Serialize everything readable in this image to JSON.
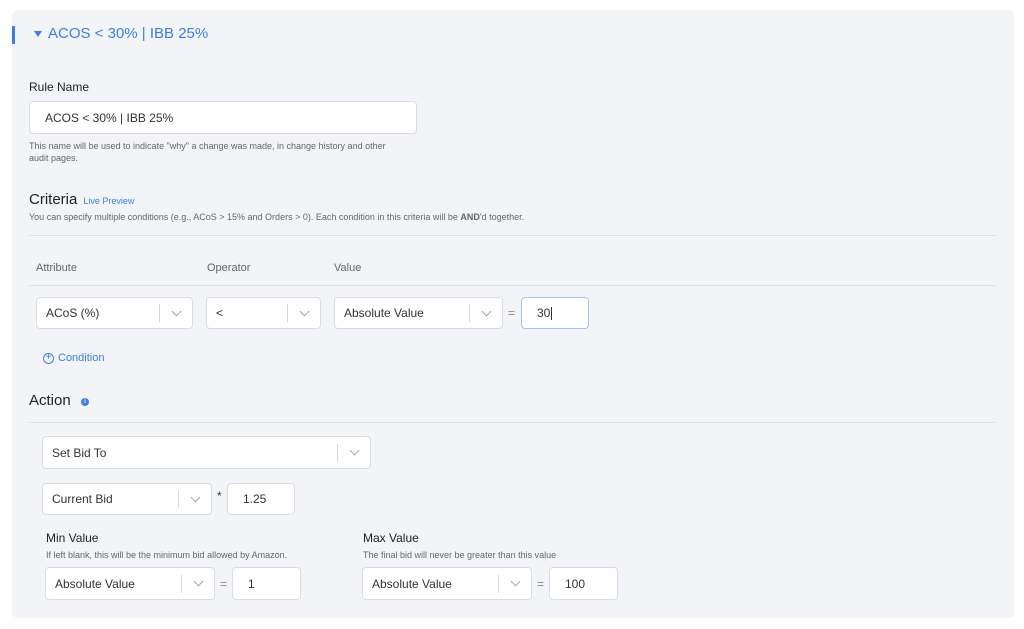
{
  "header": {
    "title": "ACOS < 30% | IBB 25%"
  },
  "rule_name": {
    "label": "Rule Name",
    "value": "ACOS < 30% | IBB 25%",
    "help_line1": "This name will be used to indicate \"why\" a change was made, in change history and other",
    "help_line2": "audit pages."
  },
  "criteria": {
    "title": "Criteria",
    "live_preview": "Live Preview",
    "help_prefix": "You can specify multiple conditions (e.g., ACoS > 15% and Orders > 0). Each condition in this criteria will be ",
    "help_bold": "AND",
    "help_suffix": "'d together.",
    "columns": {
      "attribute": "Attribute",
      "operator": "Operator",
      "value": "Value"
    },
    "row": {
      "attribute": "ACoS (%)",
      "operator": "<",
      "value_type": "Absolute Value",
      "equals": "=",
      "value": "30"
    },
    "add_condition": "Condition"
  },
  "action": {
    "title": "Action",
    "type": "Set Bid To",
    "base": "Current Bid",
    "multiply": "*",
    "multiplier": "1.25",
    "min": {
      "label": "Min Value",
      "help": "If left blank, this will be the minimum bid allowed by Amazon.",
      "type": "Absolute Value",
      "equals": "=",
      "value": "1"
    },
    "max": {
      "label": "Max Value",
      "help": "The final bid will never be greater than this value",
      "type": "Absolute Value",
      "equals": "=",
      "value": "100"
    }
  },
  "colors": {
    "accent": "#3d7fe0",
    "panel_bg": "#f2f4f8",
    "border": "#d9dde3"
  }
}
